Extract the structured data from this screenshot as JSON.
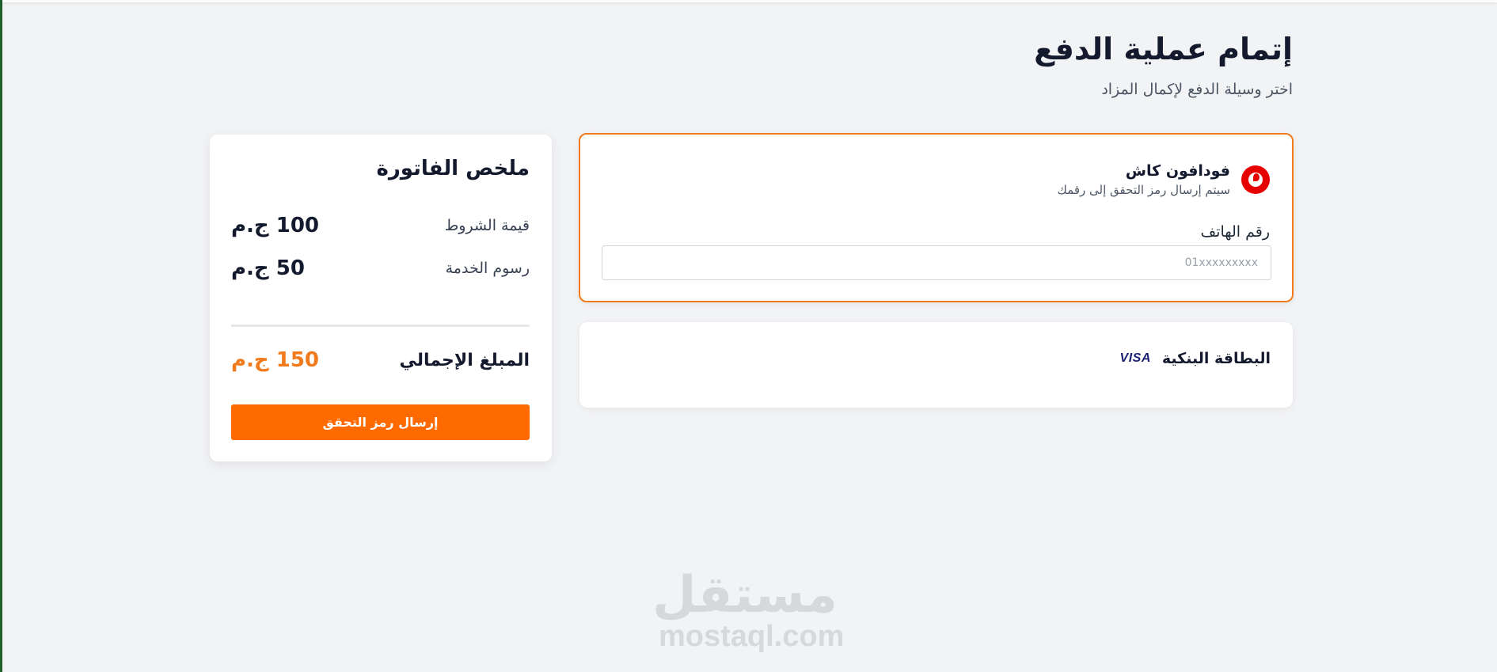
{
  "header": {
    "title": "إتمام عملية الدفع",
    "subtitle": "اختر وسيلة الدفع لإكمال المزاد"
  },
  "payment_methods": {
    "vodafone": {
      "name": "فودافون كاش",
      "description": "سيتم إرسال رمز التحقق إلى رقمك",
      "icon": "vodafone-logo",
      "phone_label": "رقم الهاتف",
      "phone_placeholder": "01xxxxxxxxx",
      "phone_value": "",
      "selected": true
    },
    "bank_card": {
      "name": "البطاقة البنكية",
      "icon": "visa-icon",
      "icon_text": "VISA",
      "selected": false
    }
  },
  "invoice": {
    "title": "ملخص الفاتورة",
    "rows": [
      {
        "label": "قيمة الشروط",
        "value": "100 ج.م"
      },
      {
        "label": "رسوم الخدمة",
        "value": "50 ج.م"
      }
    ],
    "total_label": "المبلغ الإجمالي",
    "total_value": "150 ج.م",
    "submit_label": "إرسال رمز التحقق"
  },
  "watermark": {
    "arabic": "مستقل",
    "latin": "mostaql.com"
  },
  "colors": {
    "accent": "#ff6a00",
    "selected_border": "#f07a1c",
    "vodafone_red": "#e60000",
    "background": "#f2f3f5"
  }
}
